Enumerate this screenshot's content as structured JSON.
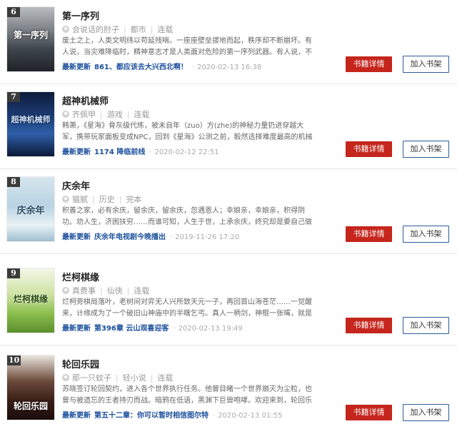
{
  "colors": {
    "detail_button_bg": "#c5251c",
    "shelf_button_border": "#2d5b9a",
    "update_text": "#1a4f9c",
    "meta_text": "#999999"
  },
  "books": [
    {
      "rank": "6",
      "cover_text": "第一序列",
      "title": "第一序列",
      "author": "会说话的肘子",
      "category": "都市",
      "status": "连载",
      "intro": "废土之上，人类文明纬以苟延残喘。一座座壁垒拔地而起，秩序却不断崩坏。有人说，当灾难降临时，精神意志才是人类面对危险的第一序列武器。有人说，不要让",
      "update_label": "最新更新",
      "update_chapter": "861、都应该去大兴西北啊！",
      "update_time": "2020-02-13 16:38",
      "detail_button": "书籍详情",
      "shelf_button": "加入书架"
    },
    {
      "rank": "7",
      "cover_text": "超神机械师",
      "title": "超神机械师",
      "author": "齐佩甲",
      "category": "游戏",
      "status": "连载",
      "intro": "韩萧，《星海》骨灰级代练，被未自年（zuo）方(zhe)的神秘力量扔进穿越大军，携带玩家面板变成NPC，回到《星海》公测之前，毅然选择难度最高的机械系。战",
      "update_label": "最新更新",
      "update_chapter": "1174 降临前线",
      "update_time": "2020-02-12 22:51",
      "detail_button": "书籍详情",
      "shelf_button": "加入书架"
    },
    {
      "rank": "8",
      "cover_text": "庆余年",
      "title": "庆余年",
      "author": "猫腻",
      "category": "历史",
      "status": "完本",
      "intro": "积善之家，必有余庆，留余庆，留余庆，忽遇恩人；幸娘亲，幸娘亲，积得阴功。劝人生，济困扶穷……而谁可知，人生于世，上承余庆，终究却是要自己做出道路",
      "update_label": "最新更新",
      "update_chapter": "庆余年电视剧今晚播出",
      "update_time": "2019-11-26 17:20",
      "detail_button": "书籍详情",
      "shelf_button": "加入书架"
    },
    {
      "rank": "9",
      "cover_text": "烂柯棋缘",
      "title": "烂柯棋缘",
      "author": "真费事",
      "category": "仙侠",
      "status": "连载",
      "intro": "烂柯旁棋局落叶，老树间对弈无人兴所致天元一子，再回首山海苍茫……一觉醒来，计缘成为了一个破旧山神庙中的半瞎乞丐。真人一柄剑，神棍一张嘴，就是计缘",
      "update_label": "最新更新",
      "update_chapter": "第396章 云山观喜迎客",
      "update_time": "2020-02-13 19:49",
      "detail_button": "书籍详情",
      "shelf_button": "加入书架"
    },
    {
      "rank": "10",
      "cover_text": "轮回乐园",
      "title": "轮回乐园",
      "author": "那一只蚊子",
      "category": "轻小说",
      "status": "连载",
      "intro": "苏晓签订轮回契约，进入各个世界执行任务。他曾目睹一个世界崩灭为尘粒，也曾与被遗忘的王者持刃而战。暗鸦在低语，黑渊下巨兽咆哮。欢迎来到，轮回乐",
      "update_label": "最新更新",
      "update_chapter": "第五十二章：你可以暂时相信图尔特",
      "update_time": "2020-02-13 01:55",
      "detail_button": "书籍详情",
      "shelf_button": "加入书架"
    }
  ]
}
